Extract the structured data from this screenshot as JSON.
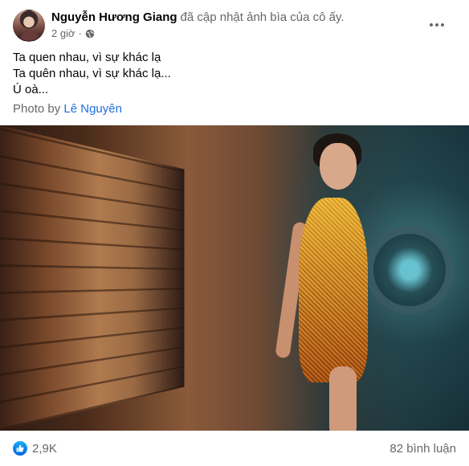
{
  "post": {
    "author": "Nguyễn Hương Giang",
    "action": "đã cập nhật ảnh bìa của cô ấy.",
    "time": "2 giờ",
    "privacy_icon": "globe-icon",
    "more_icon": "more-options-icon",
    "body_lines": [
      "Ta quen nhau, vì sự khác lạ",
      "Ta quên nhau, vì sự khác lạ...",
      "Ú oà..."
    ],
    "credit_prefix": "Photo by",
    "credit_name": "Lê Nguyên"
  },
  "footer": {
    "reaction_icon": "like-reaction-icon",
    "reaction_count": "2,9K",
    "comment_count": "82 bình luận"
  },
  "colors": {
    "secondary_text": "#65676b",
    "link": "#216fdb",
    "like_blue": "#0062e0"
  }
}
